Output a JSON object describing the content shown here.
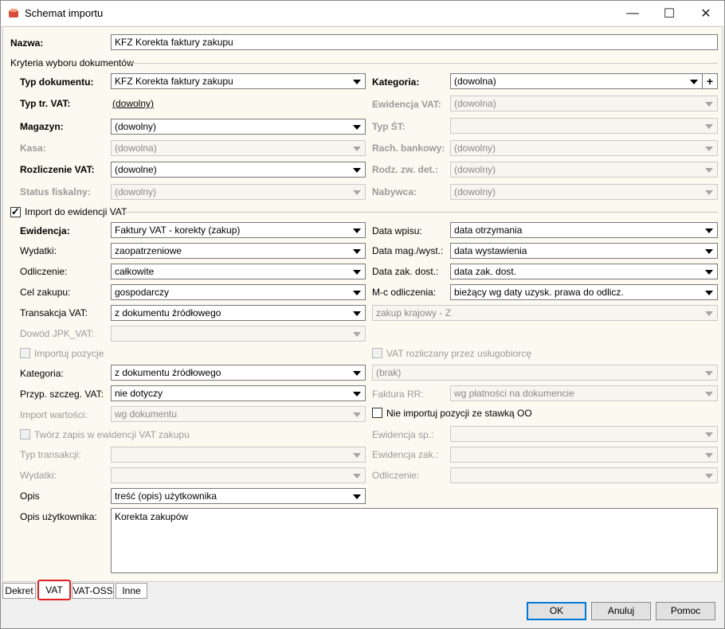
{
  "window": {
    "title": "Schemat importu",
    "minimize": "—",
    "maximize": "☐",
    "close": "✕"
  },
  "nazwa": {
    "label": "Nazwa:",
    "value": "KFZ Korekta faktury zakupu"
  },
  "kryteria": {
    "section_label": "Kryteria wyboru dokumentów",
    "typ_dokumentu": {
      "label": "Typ dokumentu:",
      "value": "KFZ Korekta faktury zakupu"
    },
    "kategoria": {
      "label": "Kategoria:",
      "value": "(dowolna)",
      "add": "+"
    },
    "typ_tr_vat": {
      "label": "Typ tr. VAT:",
      "value": "(dowolny)"
    },
    "ewidencja_vat": {
      "label": "Ewidencja VAT:",
      "value": "(dowolna)"
    },
    "magazyn": {
      "label": "Magazyn:",
      "value": "(dowolny)"
    },
    "typ_st": {
      "label": "Typ ŚT:",
      "value": ""
    },
    "kasa": {
      "label": "Kasa:",
      "value": "(dowolna)"
    },
    "rach_bankowy": {
      "label": "Rach. bankowy:",
      "value": "(dowolny)"
    },
    "rozliczenie_vat": {
      "label": "Rozliczenie VAT:",
      "value": "(dowolne)"
    },
    "rodz_zw_det": {
      "label": "Rodz. zw. det.:",
      "value": "(dowolny)"
    },
    "status_fiskalny": {
      "label": "Status fiskalny:",
      "value": "(dowolny)"
    },
    "nabywca": {
      "label": "Nabywca:",
      "value": "(dowolny)"
    }
  },
  "import_vat": {
    "checkbox_label": "Import do ewidencji VAT",
    "ewidencja": {
      "label": "Ewidencja:",
      "value": "Faktury VAT - korekty (zakup)"
    },
    "data_wpisu": {
      "label": "Data wpisu:",
      "value": "data otrzymania"
    },
    "wydatki": {
      "label": "Wydatki:",
      "value": "zaopatrzeniowe"
    },
    "data_mag": {
      "label": "Data mag./wyst.:",
      "value": "data wystawienia"
    },
    "odliczenie": {
      "label": "Odliczenie:",
      "value": "całkowite"
    },
    "data_zak": {
      "label": "Data zak. dost.:",
      "value": "data zak. dost."
    },
    "cel_zakupu": {
      "label": "Cel zakupu:",
      "value": "gospodarczy"
    },
    "mc_odliczenia": {
      "label": "M-c odliczenia:",
      "value": "bieżący wg daty uzysk. prawa do odlicz."
    },
    "transakcja_vat": {
      "label": "Transakcja VAT:",
      "value": "z dokumentu źródłowego"
    },
    "transakcja_right": {
      "value": "zakup krajowy - Z"
    },
    "dowod_jpk": {
      "label": "Dowód JPK_VAT:",
      "value": ""
    },
    "importuj_pozycje": {
      "label": "Importuj pozycje"
    },
    "vat_uslugobiorca": {
      "label": "VAT rozliczany przez usługobiorcę"
    },
    "kategoria2": {
      "label": "Kategoria:",
      "value": "z dokumentu źródłowego"
    },
    "kategoria2_right": {
      "value": "(brak)"
    },
    "przyp_szczeg": {
      "label": "Przyp. szczeg. VAT:",
      "value": "nie dotyczy"
    },
    "faktura_rr": {
      "label": "Faktura RR:",
      "value": "wg płatności na dokumencie"
    },
    "import_wartosci": {
      "label": "Import wartości:",
      "value": "wg dokumentu"
    },
    "nie_importuj": {
      "label": "Nie importuj pozycji ze stawką OO"
    },
    "tworz_zapis": {
      "label": "Twórz zapis w ewidencji VAT zakupu"
    },
    "ewidencja_sp": {
      "label": "Ewidencja sp.:",
      "value": ""
    },
    "typ_transakcji": {
      "label": "Typ transakcji:",
      "value": ""
    },
    "ewidencja_zak": {
      "label": "Ewidencja zak.:",
      "value": ""
    },
    "wydatki2": {
      "label": "Wydatki:",
      "value": ""
    },
    "odliczenie2": {
      "label": "Odliczenie:",
      "value": ""
    },
    "opis": {
      "label": "Opis",
      "value": "treść (opis) użytkownika"
    },
    "opis_uzytkownika": {
      "label": "Opis użytkownika:",
      "value": "Korekta zakupów"
    }
  },
  "tabs": [
    "Dekret",
    "VAT",
    "VAT-OSS",
    "Inne"
  ],
  "buttons": {
    "ok": "OK",
    "cancel": "Anuluj",
    "help": "Pomoc"
  },
  "colors": {
    "content_bg": "#fcf9f1",
    "highlight": "#e02020",
    "default_button": "#0078d7"
  }
}
